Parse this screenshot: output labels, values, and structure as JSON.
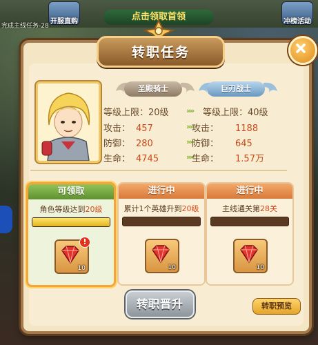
{
  "background": {
    "quest_text": "完成主线任务-28",
    "top_button_left": "开服直购",
    "top_button_right": "冲榜活动",
    "banner_text": "点击领取首领"
  },
  "dialog": {
    "title": "转职任务"
  },
  "hero": {
    "current_class": "圣殿骑士",
    "next_class": "巨刃战士",
    "stats_current": [
      {
        "label": "等级上限：",
        "value": "20级"
      },
      {
        "label": "攻击：",
        "value": "457"
      },
      {
        "label": "防御：",
        "value": "280"
      },
      {
        "label": "生命：",
        "value": "4745"
      }
    ],
    "stats_next": [
      {
        "label": "等级上限：",
        "value": "40级"
      },
      {
        "label": "攻击：",
        "value": "1188"
      },
      {
        "label": "防御：",
        "value": "645"
      },
      {
        "label": "生命：",
        "value": "1.57万"
      }
    ]
  },
  "tasks": [
    {
      "status": "可领取",
      "desc_pre": "角色等级达到",
      "desc_hl": "20级",
      "progress": 1.0,
      "reward_qty": "10",
      "has_alert": true
    },
    {
      "status": "进行中",
      "desc_pre": "累计1个英雄升到",
      "desc_hl": "20级",
      "progress": 0.0,
      "reward_qty": "10",
      "has_alert": false
    },
    {
      "status": "进行中",
      "desc_pre": "主线通关第",
      "desc_hl": "28关",
      "progress": 0.0,
      "reward_qty": "10",
      "has_alert": false
    }
  ],
  "actions": {
    "promote_label": "转职晋升",
    "preview_label": "转职预览"
  },
  "colors": {
    "accent_orange": "#f5a53a",
    "claimable_green": "#7bb22a",
    "highlight_red": "#d84a1a"
  }
}
